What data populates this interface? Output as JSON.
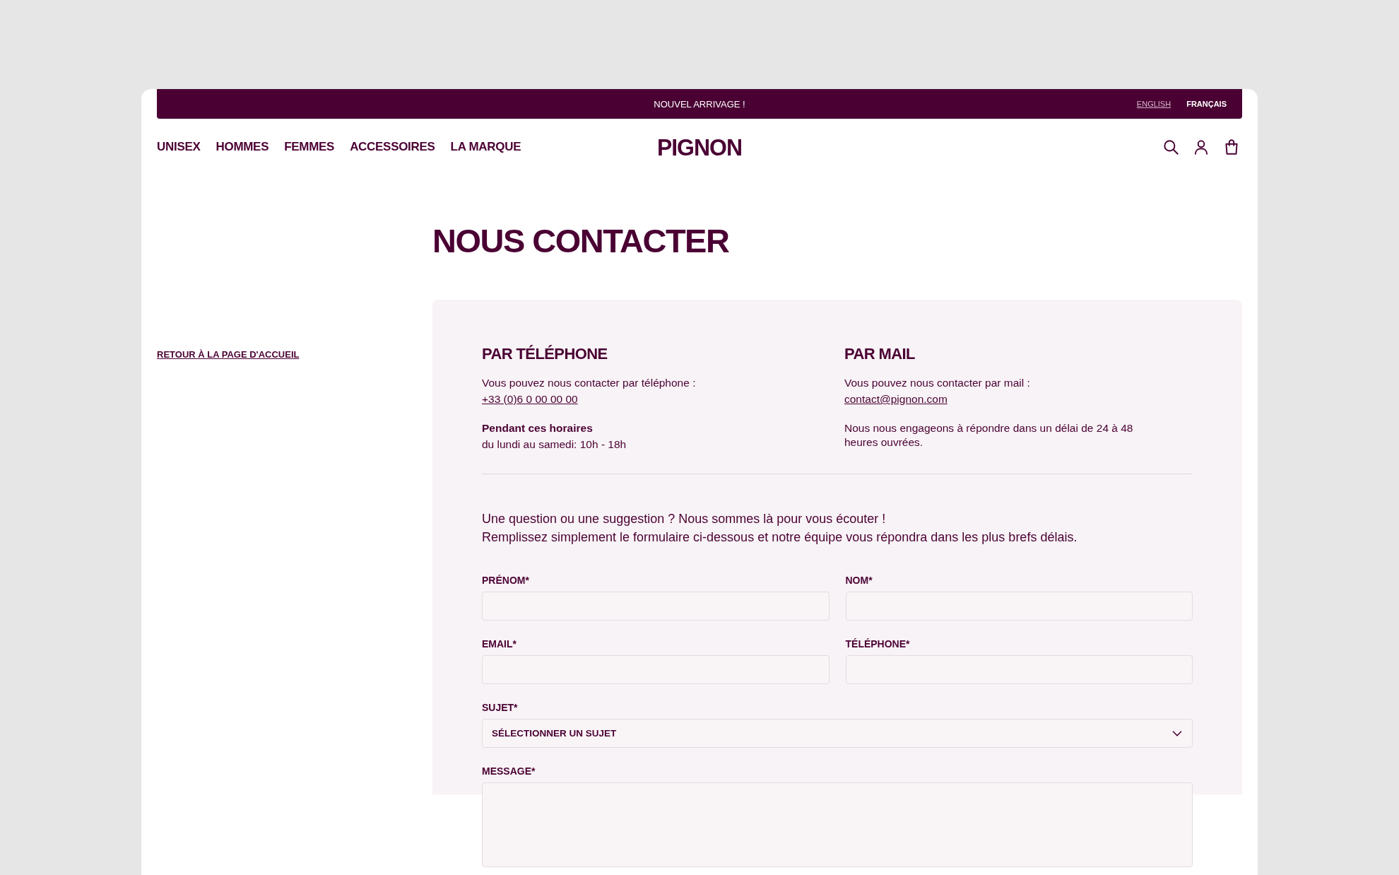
{
  "announcement": "NOUVEL ARRIVAGE !",
  "languages": [
    {
      "label": "ENGLISH",
      "selected": false
    },
    {
      "label": "FRANÇAIS",
      "selected": true
    }
  ],
  "nav": [
    "UNISEX",
    "HOMMES",
    "FEMMES",
    "ACCESSOIRES",
    "LA MARQUE"
  ],
  "logo": "PIGNON",
  "page_title": "NOUS CONTACTER",
  "back_link": "RETOUR À LA PAGE D'ACCUEIL",
  "contact_sections": [
    {
      "heading": "PAR TÉLÉPHONE",
      "intro": "Vous pouvez nous contacter par téléphone :",
      "link": "+33 (0)6 0 00 00 00",
      "note_title": "Pendant ces horaires",
      "note": "du lundi au samedi: 10h - 18h"
    },
    {
      "heading": "PAR MAIL",
      "intro": "Vous pouvez nous contacter par mail :",
      "link": "contact@pignon.com",
      "note": "Nous nous engageons à répondre dans un délai de 24 à 48 heures ouvrées."
    }
  ],
  "form_intro": [
    "Une question ou une suggestion ? Nous sommes là pour vous écouter !",
    "Remplissez simplement le formulaire ci-dessous et notre équipe vous répondra dans les plus brefs délais."
  ],
  "fields": [
    {
      "label": "PRÉNOM*",
      "kind": "text"
    },
    {
      "label": "NOM*",
      "kind": "text"
    },
    {
      "label": "EMAIL*",
      "kind": "text"
    },
    {
      "label": "TÉLÉPHONE*",
      "kind": "text"
    },
    {
      "label": "SUJET*",
      "kind": "select",
      "value": "SÉLECTIONNER UN SUJET"
    },
    {
      "label": "MESSAGE*",
      "kind": "textarea"
    }
  ]
}
